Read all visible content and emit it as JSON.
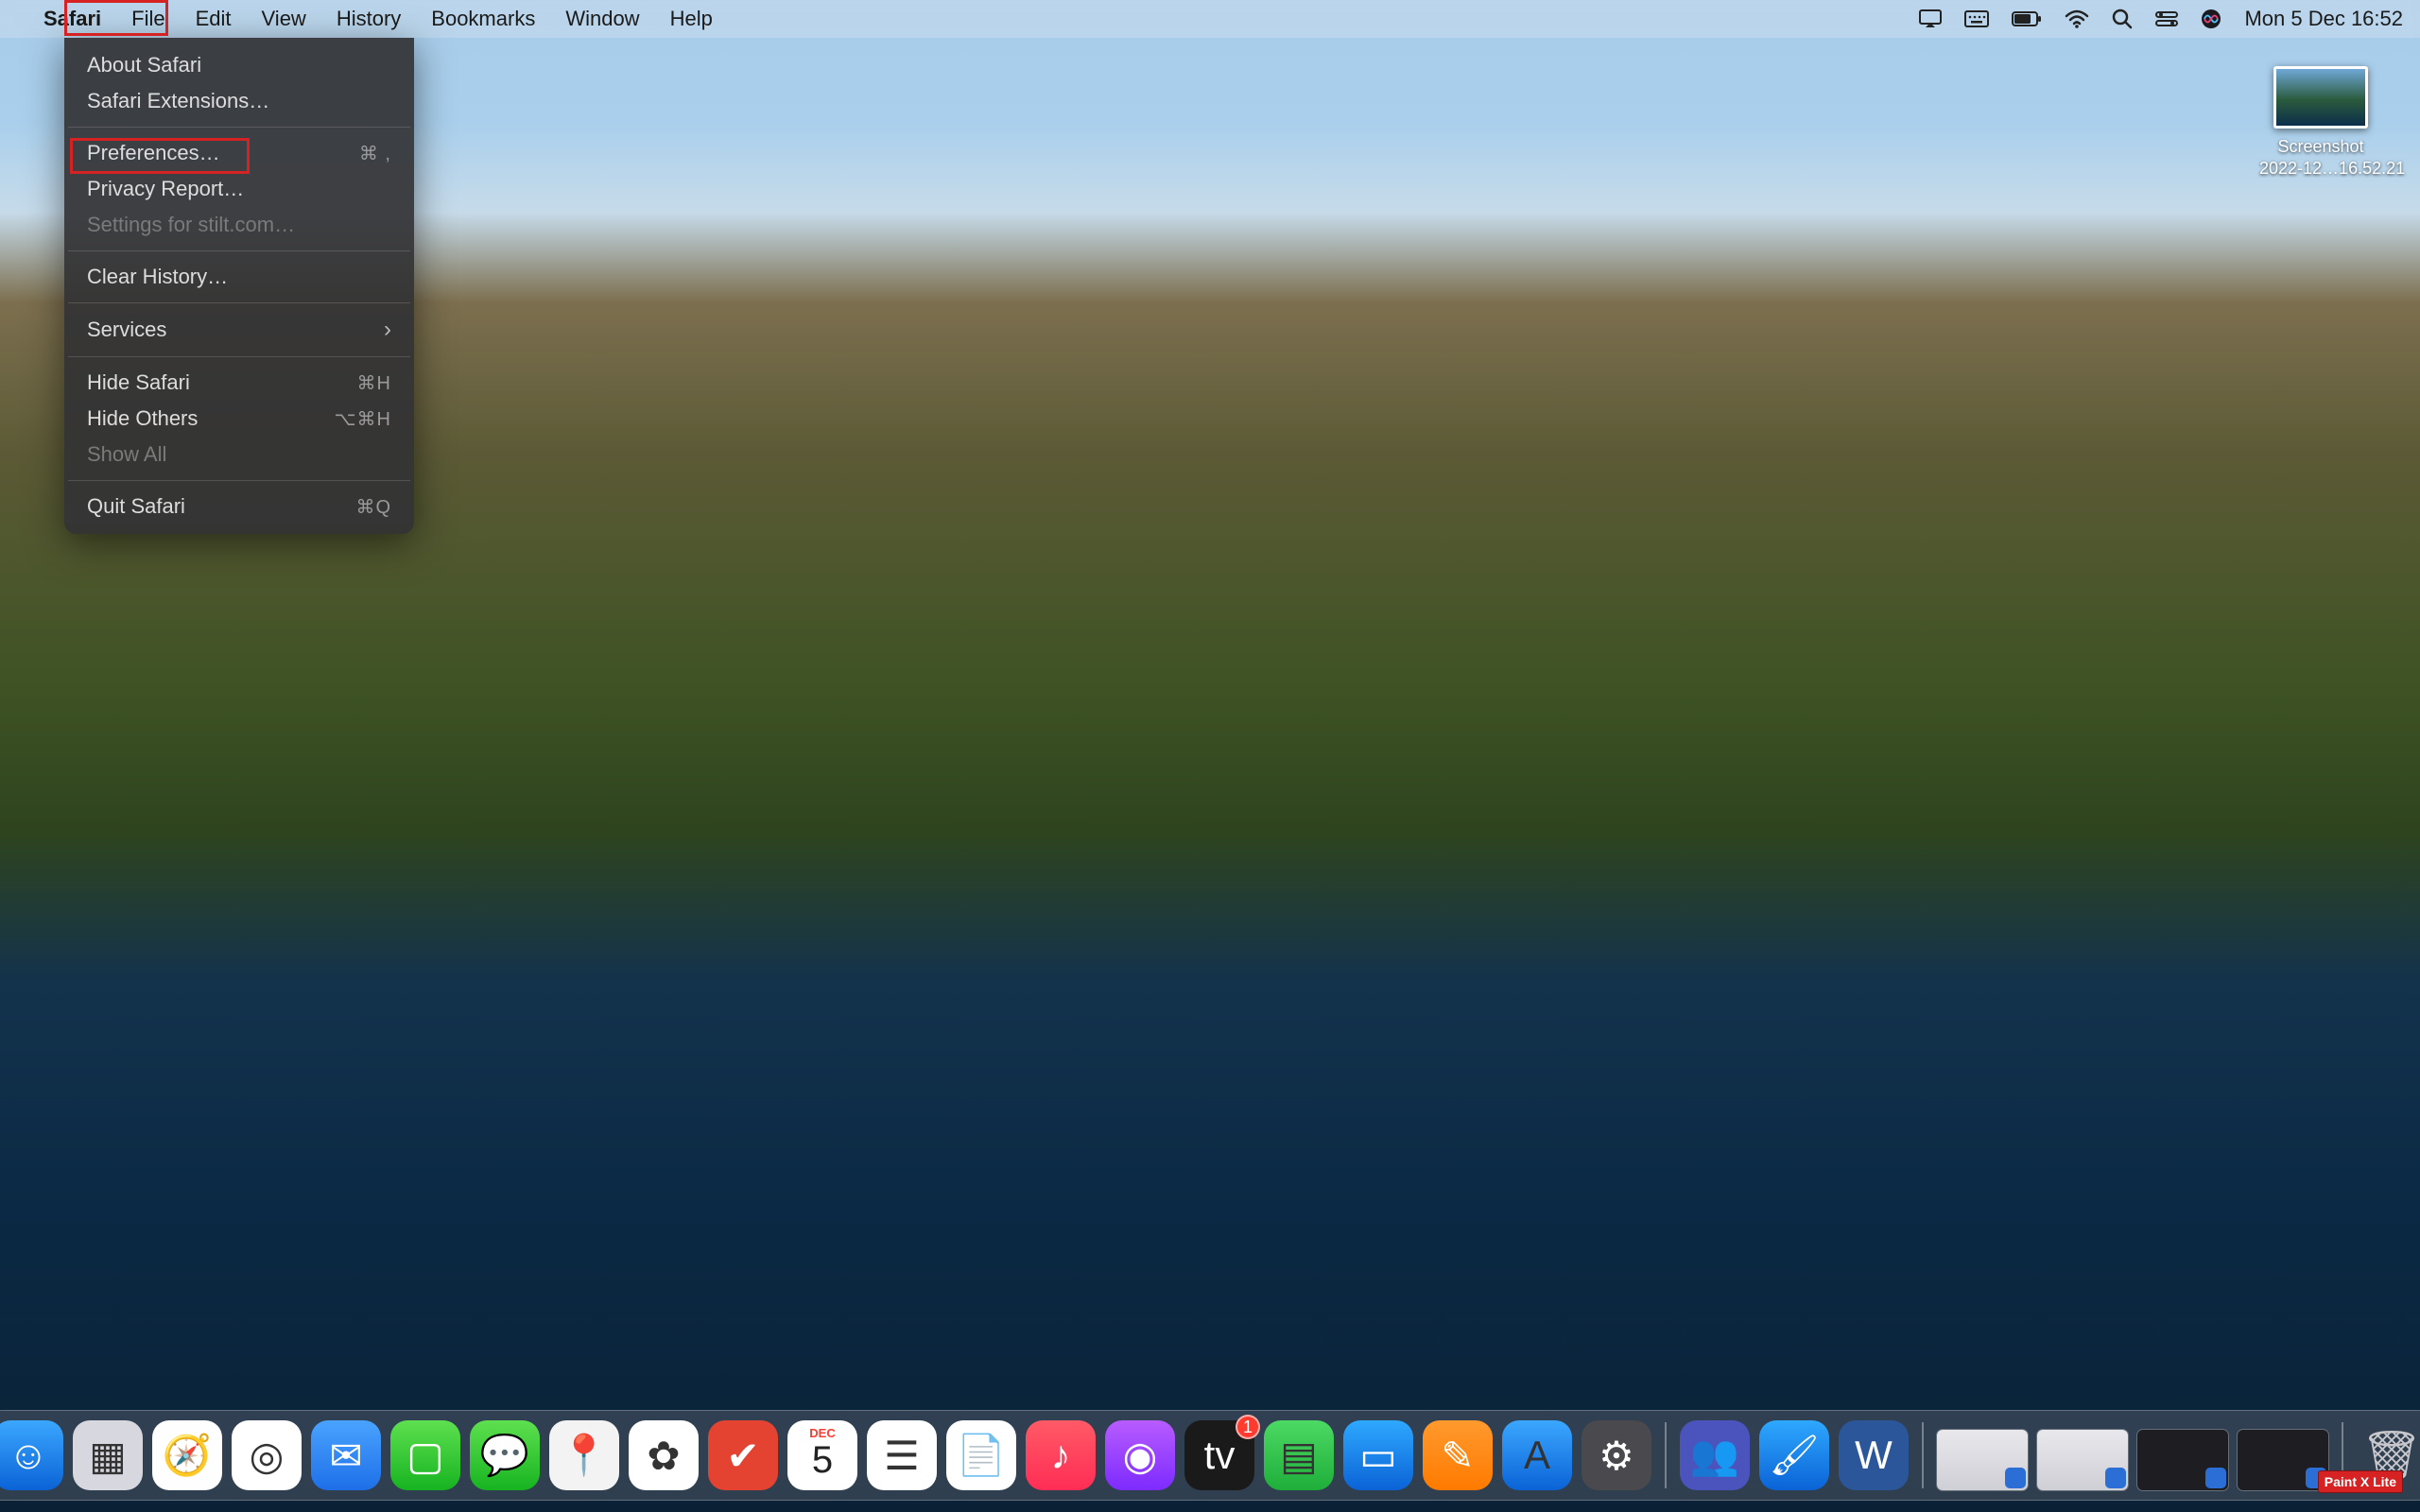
{
  "menubar": {
    "apple": "",
    "app_menu": "Safari",
    "items": [
      "File",
      "Edit",
      "View",
      "History",
      "Bookmarks",
      "Window",
      "Help"
    ],
    "clock": "Mon 5 Dec  16:52"
  },
  "status_icons": [
    "screen-mirror",
    "keyboard-brightness",
    "battery",
    "wifi",
    "spotlight",
    "control-center",
    "siri"
  ],
  "dropdown": {
    "groups": [
      [
        {
          "label": "About Safari",
          "shortcut": "",
          "disabled": false
        },
        {
          "label": "Safari Extensions…",
          "shortcut": "",
          "disabled": false
        }
      ],
      [
        {
          "label": "Preferences…",
          "shortcut": "⌘ ,",
          "disabled": false,
          "highlighted": true
        },
        {
          "label": "Privacy Report…",
          "shortcut": "",
          "disabled": false
        },
        {
          "label": "Settings for stilt.com…",
          "shortcut": "",
          "disabled": true
        }
      ],
      [
        {
          "label": "Clear History…",
          "shortcut": "",
          "disabled": false
        }
      ],
      [
        {
          "label": "Services",
          "shortcut": "›",
          "disabled": false,
          "submenu": true
        }
      ],
      [
        {
          "label": "Hide Safari",
          "shortcut": "⌘H",
          "disabled": false
        },
        {
          "label": "Hide Others",
          "shortcut": "⌥⌘H",
          "disabled": false
        },
        {
          "label": "Show All",
          "shortcut": "",
          "disabled": true
        }
      ],
      [
        {
          "label": "Quit Safari",
          "shortcut": "⌘Q",
          "disabled": false
        }
      ]
    ]
  },
  "desktop_icon": {
    "line1": "Screenshot",
    "line2": "2022-12…16.52.21"
  },
  "dock": {
    "apps": [
      {
        "name": "finder",
        "bg": "linear-gradient(#3ba7ff,#0b63d6)",
        "glyph": "☺"
      },
      {
        "name": "launchpad",
        "bg": "#d7d7df",
        "glyph": "▦"
      },
      {
        "name": "safari",
        "bg": "#fefefe",
        "glyph": "🧭"
      },
      {
        "name": "chrome",
        "bg": "#fff",
        "glyph": "◎"
      },
      {
        "name": "mail",
        "bg": "linear-gradient(#4aa3ff,#1e6fe8)",
        "glyph": "✉"
      },
      {
        "name": "facetime",
        "bg": "linear-gradient(#5ee04f,#17b321)",
        "glyph": "▢"
      },
      {
        "name": "messages",
        "bg": "linear-gradient(#5ee04f,#17b321)",
        "glyph": "💬"
      },
      {
        "name": "maps",
        "bg": "#f3f3f3",
        "glyph": "📍"
      },
      {
        "name": "photos",
        "bg": "#fff",
        "glyph": "✿"
      },
      {
        "name": "todoist",
        "bg": "#e44332",
        "glyph": "✔"
      },
      {
        "name": "calendar",
        "bg": "#fff",
        "glyph": "5",
        "label": "DEC"
      },
      {
        "name": "reminders",
        "bg": "#fff",
        "glyph": "☰"
      },
      {
        "name": "notes",
        "bg": "#fff",
        "glyph": "📄"
      },
      {
        "name": "music",
        "bg": "linear-gradient(#ff5a66,#ff2d55)",
        "glyph": "♪"
      },
      {
        "name": "podcasts",
        "bg": "linear-gradient(#b85cff,#7d2bff)",
        "glyph": "◉"
      },
      {
        "name": "appletv",
        "bg": "#1a1a1a",
        "glyph": "tv",
        "badge": "1"
      },
      {
        "name": "numbers",
        "bg": "linear-gradient(#4cd964,#1fae3a)",
        "glyph": "▤"
      },
      {
        "name": "keynote",
        "bg": "linear-gradient(#2ea8ff,#0b63d6)",
        "glyph": "▭"
      },
      {
        "name": "pages",
        "bg": "linear-gradient(#ff9a2e,#ff7a00)",
        "glyph": "✎"
      },
      {
        "name": "appstore",
        "bg": "linear-gradient(#3ba7ff,#0b63d6)",
        "glyph": "A"
      },
      {
        "name": "system-preferences",
        "bg": "#4a4a4e",
        "glyph": "⚙"
      }
    ],
    "running": [
      {
        "name": "teams",
        "bg": "#4b53bc",
        "glyph": "👥"
      },
      {
        "name": "paintx",
        "bg": "linear-gradient(#2ea8ff,#0b63d6)",
        "glyph": "🖌"
      },
      {
        "name": "word",
        "bg": "#2b579a",
        "glyph": "W"
      }
    ],
    "minimized_count": 4,
    "trash_glyph": "🗑"
  },
  "annotation_badge": "Paint X Lite"
}
